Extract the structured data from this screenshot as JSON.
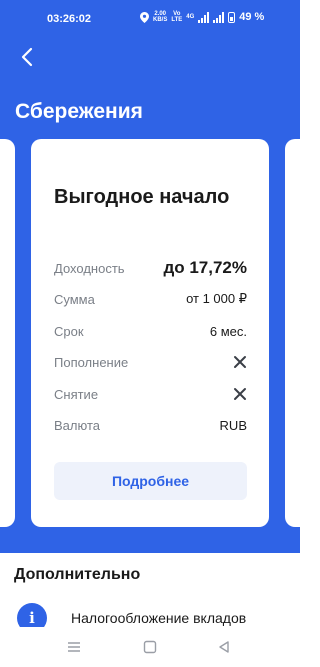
{
  "status_bar": {
    "time": "03:26:02",
    "speed_value": "2.00",
    "speed_unit": "KB/S",
    "vo_top": "Vo",
    "vo_bottom": "LTE",
    "signal_tech": "4G",
    "battery": "49 %",
    "icons": [
      "location-icon",
      "signal-icon",
      "battery-icon"
    ]
  },
  "header": {
    "back_icon": "chevron-left-icon",
    "title": "Сбережения"
  },
  "card": {
    "title": "Выгодное начало",
    "rows": [
      {
        "label": "Доходность",
        "value": "до 17,72%",
        "emphasis": true
      },
      {
        "label": "Сумма",
        "value": "от 1 000 ₽"
      },
      {
        "label": "Срок",
        "value": "6 мес."
      },
      {
        "label": "Пополнение",
        "value": "",
        "icon": "close-icon"
      },
      {
        "label": "Снятие",
        "value": "",
        "icon": "close-icon"
      },
      {
        "label": "Валюта",
        "value": "RUB"
      }
    ],
    "button_label": "Подробнее"
  },
  "extra": {
    "title": "Дополнительно",
    "item_label": "Налогообложение вкладов",
    "item_icon": "info-icon"
  },
  "nav": {
    "icons": [
      "menu-icon",
      "home-icon",
      "back-triangle-icon"
    ]
  },
  "colors": {
    "brand_blue": "#2f63e6",
    "button_bg": "#eef2fb",
    "label_gray": "#7a7f87"
  }
}
